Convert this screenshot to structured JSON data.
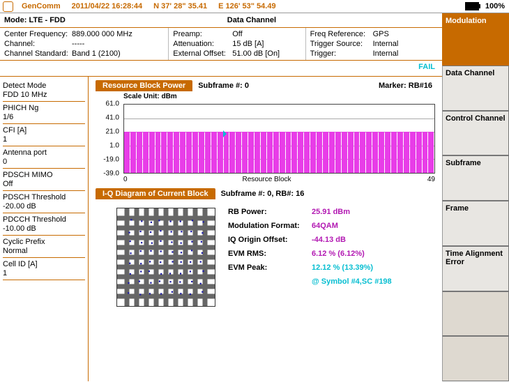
{
  "header": {
    "app": "GenComm",
    "datetime": "2011/04/22 16:28:44",
    "lat": "N 37' 28\" 35.41",
    "lon": "E 126' 53\" 54.49",
    "battery_pct": "100%"
  },
  "mode": {
    "label": "Mode:",
    "value": "LTE - FDD",
    "center_title": "Data Channel"
  },
  "params": {
    "c1": {
      "center_freq_k": "Center Frequency:",
      "center_freq_v": "889.000 000 MHz",
      "channel_k": "Channel:",
      "channel_v": "-----",
      "std_k": "Channel Standard:",
      "std_v": "Band 1 (2100)"
    },
    "c2": {
      "preamp_k": "Preamp:",
      "preamp_v": "Off",
      "atten_k": "Attenuation:",
      "atten_v": "15 dB  [A]",
      "ext_k": "External Offset:",
      "ext_v": "51.00 dB [On]"
    },
    "c3": {
      "freqref_k": "Freq Reference:",
      "freqref_v": "GPS",
      "trigsrc_k": "Trigger Source:",
      "trigsrc_v": "Internal",
      "trig_k": "Trigger:",
      "trig_v": "Internal"
    }
  },
  "status": {
    "text": "FAIL"
  },
  "left": [
    {
      "k": "Detect Mode",
      "v": "FDD 10 MHz"
    },
    {
      "k": "PHICH Ng",
      "v": "1/6"
    },
    {
      "k": "CFI [A]",
      "v": "1"
    },
    {
      "k": "Antenna port",
      "v": "0"
    },
    {
      "k": "PDSCH MIMO",
      "v": "Off"
    },
    {
      "k": "PDSCH Threshold",
      "v": "-20.00 dB"
    },
    {
      "k": "PDCCH Threshold",
      "v": "-10.00 dB"
    },
    {
      "k": "Cyclic Prefix",
      "v": "Normal"
    },
    {
      "k": "Cell ID [A]",
      "v": "1"
    }
  ],
  "chart1": {
    "title_tab": "Resource Block Power",
    "subframe": "Subframe #: 0",
    "marker": "Marker: RB#16",
    "scale": "Scale Unit: dBm",
    "yticks": [
      "61.0",
      "41.0",
      "21.0",
      "1.0",
      "-19.0",
      "-39.0"
    ],
    "x0": "0",
    "x1": "49",
    "xlabel": "Resource Block"
  },
  "iq": {
    "title_tab": "I-Q Diagram of Current Block",
    "sub": "Subframe #: 0, RB#: 16",
    "rb_power_k": "RB Power:",
    "rb_power_v": "25.91 dBm",
    "mod_k": "Modulation Format:",
    "mod_v": "64QAM",
    "iqo_k": "IQ Origin Offset:",
    "iqo_v": "-44.13 dB",
    "evmr_k": "EVM RMS:",
    "evmr_v": "6.12 % (6.12%)",
    "evmp_k": "EVM Peak:",
    "evmp_v": "12.12 % (13.39%)",
    "evmp_sub": "@ Symbol #4,SC #198"
  },
  "right": {
    "current": "Modulation",
    "buttons": [
      "Data Channel",
      "Control Channel",
      "Subframe",
      "Frame",
      "Time Alignment Error",
      "",
      ""
    ]
  },
  "chart_data": [
    {
      "type": "bar",
      "title": "Resource Block Power",
      "xlabel": "Resource Block",
      "ylabel": "dBm",
      "ylim": [
        -39,
        61
      ],
      "categories": [
        0,
        1,
        2,
        3,
        4,
        5,
        6,
        7,
        8,
        9,
        10,
        11,
        12,
        13,
        14,
        15,
        16,
        17,
        18,
        19,
        20,
        21,
        22,
        23,
        24,
        25,
        26,
        27,
        28,
        29,
        30,
        31,
        32,
        33,
        34,
        35,
        36,
        37,
        38,
        39,
        40,
        41,
        42,
        43,
        44,
        45,
        46,
        47,
        48,
        49
      ],
      "values": [
        22,
        22,
        22,
        22,
        22,
        22,
        22,
        22,
        22,
        22,
        22,
        22,
        22,
        22,
        22,
        26,
        22,
        22,
        22,
        22,
        22,
        22,
        22,
        22,
        22,
        22,
        22,
        22,
        22,
        22,
        22,
        22,
        22,
        22,
        22,
        22,
        22,
        22,
        22,
        22,
        22,
        22,
        22,
        22,
        22,
        22,
        22,
        22,
        22,
        22
      ]
    },
    {
      "type": "scatter",
      "title": "I-Q Diagram of Current Block (64QAM)",
      "xlabel": "I",
      "ylabel": "Q",
      "xlim": [
        -1,
        1
      ],
      "ylim": [
        -1,
        1
      ],
      "x": [
        -0.82,
        -0.58,
        -0.35,
        -0.12,
        0.12,
        0.35,
        0.58,
        0.82,
        -0.82,
        -0.58,
        -0.35,
        -0.12,
        0.12,
        0.35,
        0.58,
        0.82,
        -0.82,
        -0.58,
        -0.35,
        -0.12,
        0.12,
        0.35,
        0.58,
        0.82,
        -0.82,
        -0.58,
        -0.35,
        -0.12,
        0.12,
        0.35,
        0.58,
        0.82,
        -0.82,
        -0.58,
        -0.35,
        -0.12,
        0.12,
        0.35,
        0.58,
        0.82,
        -0.82,
        -0.58,
        -0.35,
        -0.12,
        0.12,
        0.35,
        0.58,
        0.82,
        -0.82,
        -0.58,
        -0.35,
        -0.12,
        0.12,
        0.35,
        0.58,
        0.82,
        -0.82,
        -0.58,
        -0.35,
        -0.12,
        0.12,
        0.35,
        0.58,
        0.82
      ],
      "y": [
        -0.82,
        -0.82,
        -0.82,
        -0.82,
        -0.82,
        -0.82,
        -0.82,
        -0.82,
        -0.58,
        -0.58,
        -0.58,
        -0.58,
        -0.58,
        -0.58,
        -0.58,
        -0.58,
        -0.35,
        -0.35,
        -0.35,
        -0.35,
        -0.35,
        -0.35,
        -0.35,
        -0.35,
        -0.12,
        -0.12,
        -0.12,
        -0.12,
        -0.12,
        -0.12,
        -0.12,
        -0.12,
        0.12,
        0.12,
        0.12,
        0.12,
        0.12,
        0.12,
        0.12,
        0.12,
        0.35,
        0.35,
        0.35,
        0.35,
        0.35,
        0.35,
        0.35,
        0.35,
        0.58,
        0.58,
        0.58,
        0.58,
        0.58,
        0.58,
        0.58,
        0.58,
        0.82,
        0.82,
        0.82,
        0.82,
        0.82,
        0.82,
        0.82,
        0.82
      ]
    }
  ]
}
